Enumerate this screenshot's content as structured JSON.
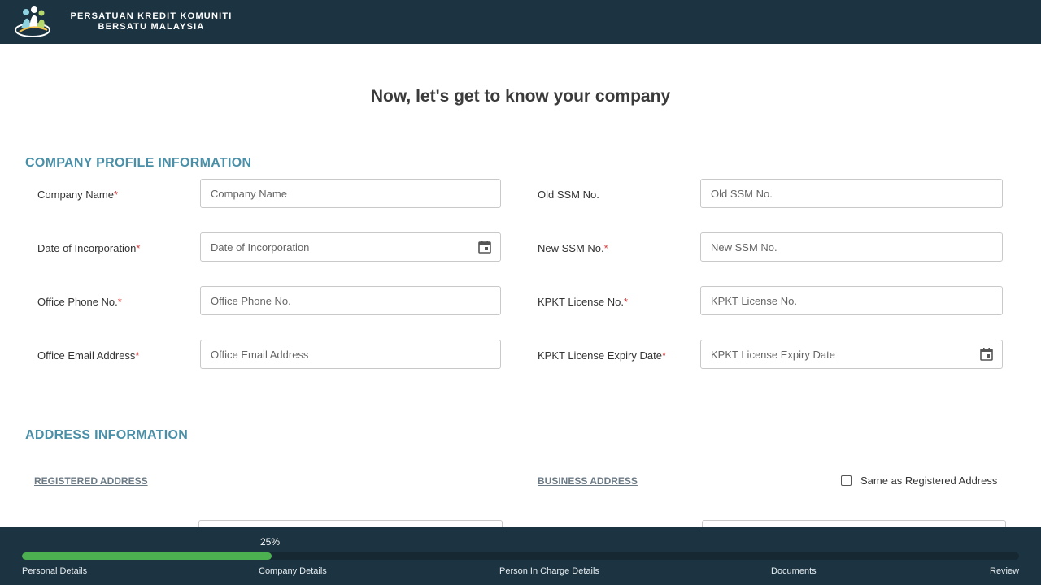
{
  "header": {
    "brand_line1": "PERSATUAN KREDIT KOMUNITI",
    "brand_line2": "BERSATU MALAYSIA",
    "logo_icon": "people-logo-icon"
  },
  "main": {
    "title": "Now, let's get to know your company",
    "company_section": {
      "title": "COMPANY PROFILE INFORMATION",
      "fields": {
        "company_name": {
          "label": "Company Name",
          "required": "*",
          "placeholder": "Company Name",
          "value": ""
        },
        "old_ssm": {
          "label": "Old SSM No.",
          "required": "",
          "placeholder": "Old SSM No.",
          "value": ""
        },
        "date_incorporation": {
          "label": "Date of Incorporation",
          "required": "*",
          "placeholder": "Date of Incorporation",
          "value": ""
        },
        "new_ssm": {
          "label": "New SSM No.",
          "required": "*",
          "placeholder": "New SSM No.",
          "value": ""
        },
        "office_phone": {
          "label": "Office Phone No.",
          "required": "*",
          "placeholder": "Office Phone No.",
          "value": ""
        },
        "kpkt_license": {
          "label": "KPKT License No.",
          "required": "*",
          "placeholder": "KPKT License No.",
          "value": ""
        },
        "office_email": {
          "label": "Office Email Address",
          "required": "*",
          "placeholder": "Office Email Address",
          "value": ""
        },
        "kpkt_expiry": {
          "label": "KPKT License Expiry Date",
          "required": "*",
          "placeholder": "KPKT License Expiry Date",
          "value": ""
        }
      }
    },
    "address_section": {
      "title": "ADDRESS INFORMATION",
      "registered_label": "REGISTERED ADDRESS",
      "business_label": "BUSINESS ADDRESS",
      "same_as_label": "Same as Registered Address",
      "same_as_checked": false
    }
  },
  "progress": {
    "percent_text": "25%",
    "percent_value": 25,
    "steps": [
      "Personal Details",
      "Company Details",
      "Person In Charge Details",
      "Documents",
      "Review"
    ]
  },
  "colors": {
    "header_bg": "#1c3442",
    "accent": "#4a8fa8",
    "progress_fill": "#4caf50",
    "required": "#d63a3a"
  }
}
